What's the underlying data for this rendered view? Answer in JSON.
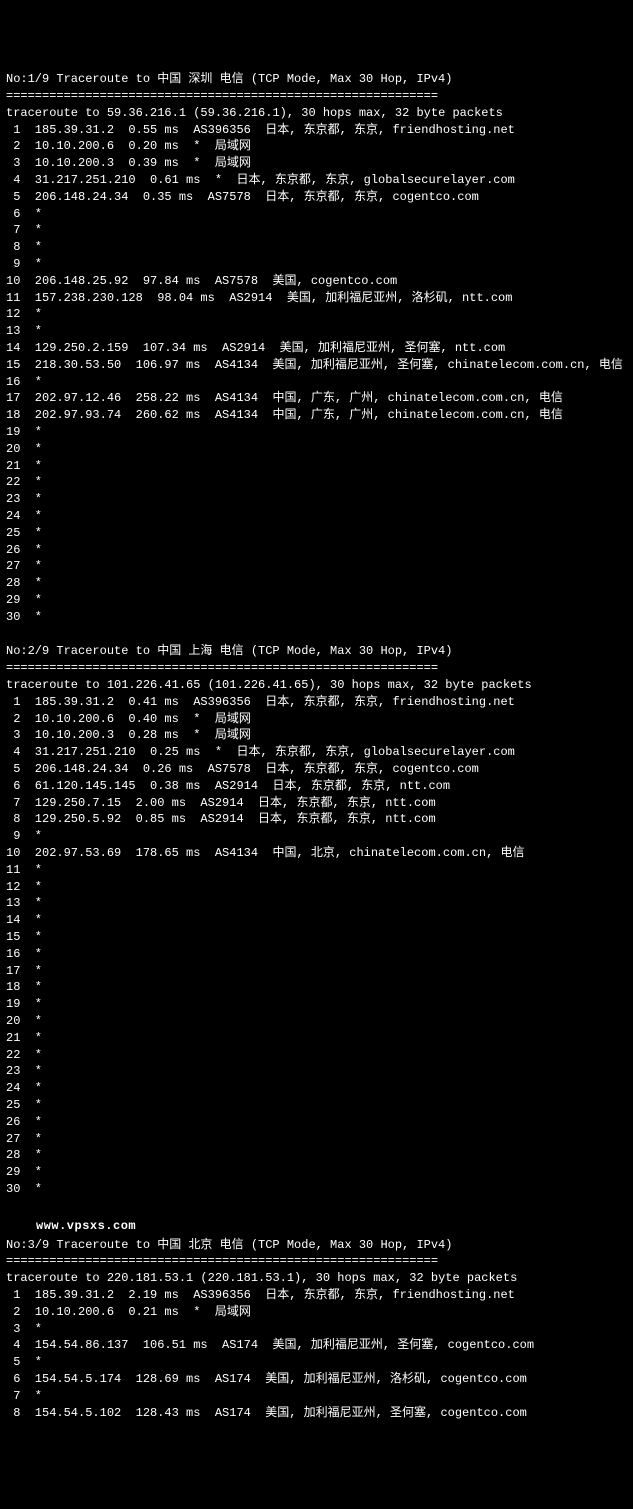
{
  "watermark": "www.vpsxs.com",
  "blocks": [
    {
      "header": "No:1/9 Traceroute to 中国 深圳 电信 (TCP Mode, Max 30 Hop, IPv4)",
      "dashline": "============================================================",
      "subheader": "traceroute to 59.36.216.1 (59.36.216.1), 30 hops max, 32 byte packets",
      "hops": [
        " 1  185.39.31.2  0.55 ms  AS396356  日本, 东京都, 东京, friendhosting.net",
        " 2  10.10.200.6  0.20 ms  *  局域网",
        " 3  10.10.200.3  0.39 ms  *  局域网",
        " 4  31.217.251.210  0.61 ms  *  日本, 东京都, 东京, globalsecurelayer.com",
        " 5  206.148.24.34  0.35 ms  AS7578  日本, 东京都, 东京, cogentco.com",
        " 6  *",
        " 7  *",
        " 8  *",
        " 9  *",
        "10  206.148.25.92  97.84 ms  AS7578  美国, cogentco.com",
        "11  157.238.230.128  98.04 ms  AS2914  美国, 加利福尼亚州, 洛杉矶, ntt.com",
        "12  *",
        "13  *",
        "14  129.250.2.159  107.34 ms  AS2914  美国, 加利福尼亚州, 圣何塞, ntt.com",
        "15  218.30.53.50  106.97 ms  AS4134  美国, 加利福尼亚州, 圣何塞, chinatelecom.com.cn, 电信",
        "16  *",
        "17  202.97.12.46  258.22 ms  AS4134  中国, 广东, 广州, chinatelecom.com.cn, 电信",
        "18  202.97.93.74  260.62 ms  AS4134  中国, 广东, 广州, chinatelecom.com.cn, 电信",
        "19  *",
        "20  *",
        "21  *",
        "22  *",
        "23  *",
        "24  *",
        "25  *",
        "26  *",
        "27  *",
        "28  *",
        "29  *",
        "30  *"
      ]
    },
    {
      "header": "No:2/9 Traceroute to 中国 上海 电信 (TCP Mode, Max 30 Hop, IPv4)",
      "dashline": "============================================================",
      "subheader": "traceroute to 101.226.41.65 (101.226.41.65), 30 hops max, 32 byte packets",
      "hops": [
        " 1  185.39.31.2  0.41 ms  AS396356  日本, 东京都, 东京, friendhosting.net",
        " 2  10.10.200.6  0.40 ms  *  局域网",
        " 3  10.10.200.3  0.28 ms  *  局域网",
        " 4  31.217.251.210  0.25 ms  *  日本, 东京都, 东京, globalsecurelayer.com",
        " 5  206.148.24.34  0.26 ms  AS7578  日本, 东京都, 东京, cogentco.com",
        " 6  61.120.145.145  0.38 ms  AS2914  日本, 东京都, 东京, ntt.com",
        " 7  129.250.7.15  2.00 ms  AS2914  日本, 东京都, 东京, ntt.com",
        " 8  129.250.5.92  0.85 ms  AS2914  日本, 东京都, 东京, ntt.com",
        " 9  *",
        "10  202.97.53.69  178.65 ms  AS4134  中国, 北京, chinatelecom.com.cn, 电信",
        "11  *",
        "12  *",
        "13  *",
        "14  *",
        "15  *",
        "16  *",
        "17  *",
        "18  *",
        "19  *",
        "20  *",
        "21  *",
        "22  *",
        "23  *",
        "24  *",
        "25  *",
        "26  *",
        "27  *",
        "28  *",
        "29  *",
        "30  *"
      ]
    },
    {
      "header": "No:3/9 Traceroute to 中国 北京 电信 (TCP Mode, Max 30 Hop, IPv4)",
      "dashline": "============================================================",
      "subheader": "traceroute to 220.181.53.1 (220.181.53.1), 30 hops max, 32 byte packets",
      "hops": [
        " 1  185.39.31.2  2.19 ms  AS396356  日本, 东京都, 东京, friendhosting.net",
        " 2  10.10.200.6  0.21 ms  *  局域网",
        " 3  *",
        " 4  154.54.86.137  106.51 ms  AS174  美国, 加利福尼亚州, 圣何塞, cogentco.com",
        " 5  *",
        " 6  154.54.5.174  128.69 ms  AS174  美国, 加利福尼亚州, 洛杉矶, cogentco.com",
        " 7  *",
        " 8  154.54.5.102  128.43 ms  AS174  美国, 加利福尼亚州, 圣何塞, cogentco.com"
      ]
    }
  ]
}
